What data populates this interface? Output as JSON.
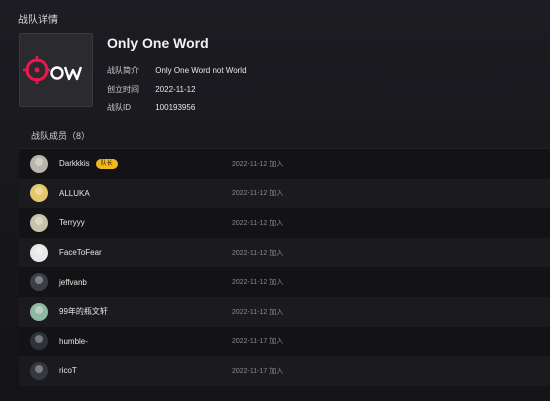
{
  "page": {
    "title": "战队详情"
  },
  "team": {
    "logo_text": "OW",
    "name": "Only One Word",
    "info": [
      {
        "label": "战队简介",
        "value": "Only One Word not World"
      },
      {
        "label": "创立时间",
        "value": "2022-11-12"
      },
      {
        "label": "战队ID",
        "value": "100193956"
      }
    ]
  },
  "members": {
    "header": "战队成员（8）",
    "captain_badge": "队长",
    "rows": [
      {
        "name": "Darkkkis",
        "joined": "2022-11-12 加入",
        "captain": true,
        "avatar_color": "#b9b4ad"
      },
      {
        "name": "ALLUKA",
        "joined": "2022-11-12 加入",
        "captain": false,
        "avatar_color": "#e3c76a"
      },
      {
        "name": "Terryyy",
        "joined": "2022-11-12 加入",
        "captain": false,
        "avatar_color": "#c8c2a8"
      },
      {
        "name": "FaceToFear",
        "joined": "2022-11-12 加入",
        "captain": false,
        "avatar_color": "#e8e8e8"
      },
      {
        "name": "jeffvanb",
        "joined": "2022-11-12 加入",
        "captain": false,
        "avatar_color": "#3c3f45"
      },
      {
        "name": "99年的瓶文轩",
        "joined": "2022-11-12 加入",
        "captain": false,
        "avatar_color": "#8fb8a0"
      },
      {
        "name": "humble-",
        "joined": "2022-11-17 加入",
        "captain": false,
        "avatar_color": "#2f3238"
      },
      {
        "name": "ricoT",
        "joined": "2022-11-17 加入",
        "captain": false,
        "avatar_color": "#35383e"
      }
    ]
  },
  "colors": {
    "logo_accent": "#e8194b",
    "badge": "#f5b623"
  }
}
